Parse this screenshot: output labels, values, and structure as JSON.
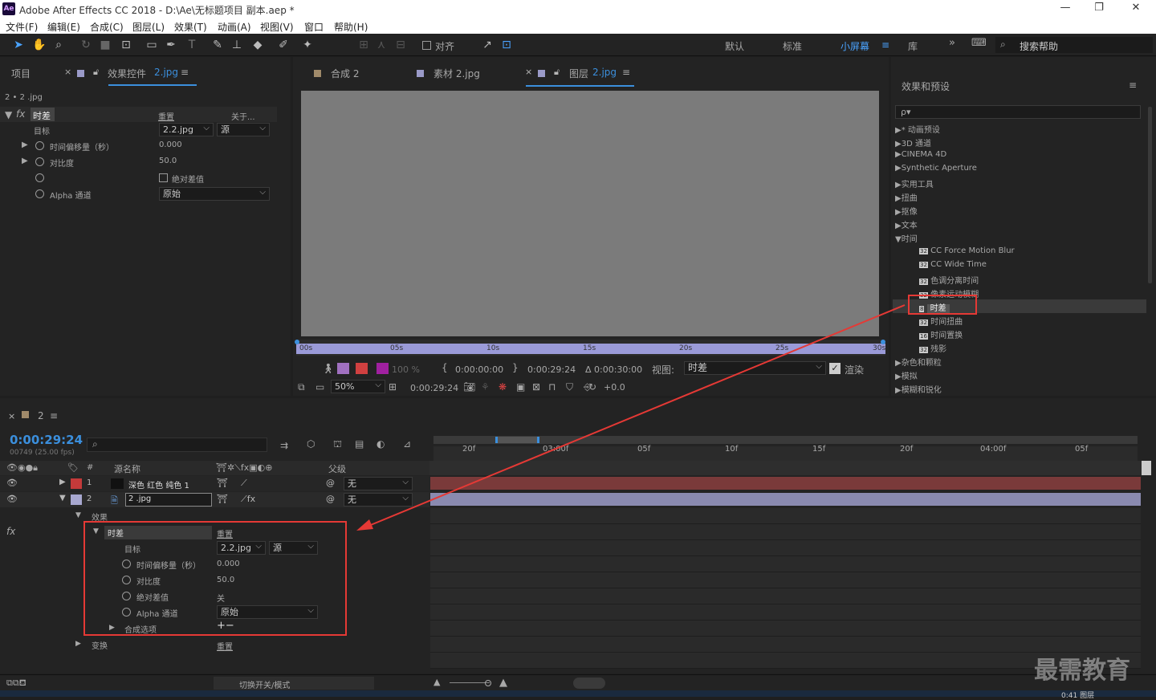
{
  "title": "Adobe After Effects CC 2018 - D:\\Ae\\无标题项目 副本.aep *",
  "logo": "Ae",
  "window_controls": {
    "min": "—",
    "max": "❐",
    "close": "✕"
  },
  "menu": [
    "文件(F)",
    "编辑(E)",
    "合成(C)",
    "图层(L)",
    "效果(T)",
    "动画(A)",
    "视图(V)",
    "窗口",
    "帮助(H)"
  ],
  "toolbar": {
    "align": "对齐",
    "workspaces": [
      "默认",
      "标准",
      "小屏幕",
      "库"
    ],
    "active_workspace": "小屏幕",
    "search_help": "搜索帮助"
  },
  "left_panel": {
    "tab_project": "项目",
    "tab_effects_prefix": "效果控件",
    "tab_effects_layer": "2.jpg",
    "breadcrumb": "2 • 2 .jpg",
    "effect_name": "时差",
    "reset": "重置",
    "about": "关于...",
    "target_label": "目标",
    "target_value": "2.2.jpg",
    "target_source": "源",
    "offset_label": "时间偏移量（秒）",
    "offset_value": "0.000",
    "contrast_label": "对比度",
    "contrast_value": "50.0",
    "absdiff_label": "绝对差值",
    "alpha_label": "Alpha 通道",
    "alpha_value": "原始"
  },
  "comp_panel": {
    "tabs": [
      {
        "label": "合成 2",
        "color": "#a08a6a"
      },
      {
        "label": "素材 2.jpg",
        "color": "#9a9ac8"
      },
      {
        "label": "图层",
        "suffix": "2.jpg",
        "color": "#9a9ac8"
      }
    ],
    "ruler": [
      "00s",
      "05s",
      "10s",
      "15s",
      "20s",
      "25s",
      "30s"
    ],
    "opacity": "100 %",
    "time_in": "0:00:00:00",
    "time_out": "0:00:29:24",
    "duration": "Δ 0:00:30:00",
    "view_label": "视图:",
    "view_value": "时差",
    "render_label": "渲染",
    "zoom": "50%",
    "current_time": "0:00:29:24",
    "exposure": "+0.0"
  },
  "effects_presets": {
    "title": "效果和预设",
    "search_placeholder": "ρ▾",
    "categories": [
      "* 动画预设",
      "3D 通道",
      "CINEMA 4D",
      "Synthetic Aperture",
      "实用工具",
      "扭曲",
      "抠像",
      "文本"
    ],
    "open_category": "时间",
    "time_items": [
      "CC Force Motion Blur",
      "CC Wide Time",
      "色调分离时间",
      "像素运动模糊",
      "时差",
      "时间扭曲",
      "时间置换",
      "残影"
    ],
    "selected": "时差",
    "after": [
      "杂色和颗粒",
      "模拟",
      "模糊和锐化"
    ]
  },
  "timeline": {
    "comp_tab": "2",
    "timecode": "0:00:29:24",
    "fps": "00749 (25.00 fps)",
    "headers": {
      "source": "源名称",
      "parent": "父级"
    },
    "ruler": [
      "20f",
      "03:00f",
      "05f",
      "10f",
      "15f",
      "20f",
      "04:00f",
      "05f"
    ],
    "layers": [
      {
        "num": "1",
        "name": "深色 红色 纯色 1",
        "parent": "无",
        "color": "#c43a3a"
      },
      {
        "num": "2",
        "name": "2 .jpg",
        "parent": "无",
        "color": "#a8a8d0"
      }
    ],
    "effects_group": "效果",
    "effect_name": "时差",
    "reset": "重置",
    "target_label": "目标",
    "target_value": "2.2.jpg",
    "target_source": "源",
    "offset_label": "时间偏移量（秒）",
    "offset_value": "0.000",
    "contrast_label": "对比度",
    "contrast_value": "50.0",
    "absdiff_label": "绝对差值",
    "absdiff_value": "关",
    "alpha_label": "Alpha 通道",
    "alpha_value": "原始",
    "compositing_label": "合成选项",
    "compositing_value": "+−",
    "transform_label": "变换",
    "transform_reset": "重置",
    "toggle_label": "切换开关/模式"
  },
  "watermark": "最需教育",
  "status_partial": "0:41 图层"
}
